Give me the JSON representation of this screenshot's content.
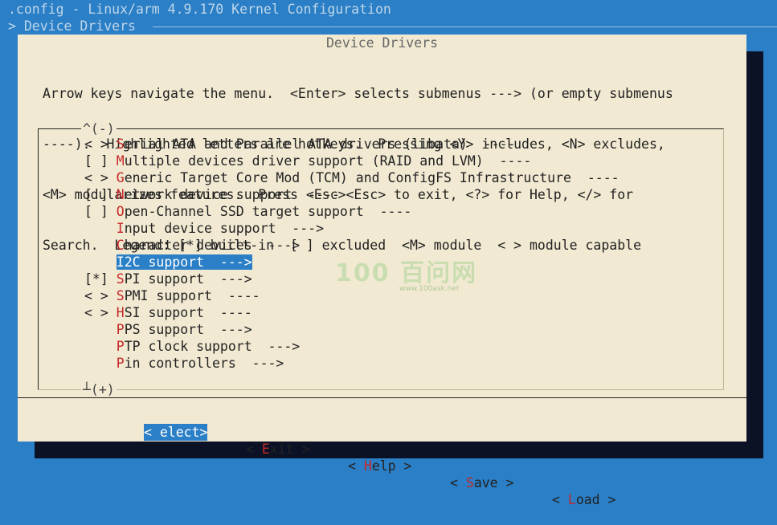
{
  "window": {
    "title": ".config - Linux/arm 4.9.170 Kernel Configuration",
    "breadcrumb": "> Device Drivers"
  },
  "dialog": {
    "title": "Device Drivers",
    "help_lines": [
      "Arrow keys navigate the menu.  <Enter> selects submenus ---> (or empty submenus",
      "----).  Highlighted letters are hotkeys.  Pressing <Y> includes, <N> excludes,",
      "<M> modularizes features.  Press <Esc><Esc> to exit, <?> for Help, </> for",
      "Search.  Legend: [*] built-in  [ ] excluded  <M> module  < > module capable"
    ],
    "scroll_up": "^(-)",
    "scroll_down": "┴(+)"
  },
  "menu": {
    "items": [
      {
        "prefix": "< > ",
        "hotkey": "S",
        "rest": "erial ATA and Parallel ATA drivers (libata)  ----"
      },
      {
        "prefix": "[ ] ",
        "hotkey": "M",
        "rest": "ultiple devices driver support (RAID and LVM)  ----"
      },
      {
        "prefix": "< > ",
        "hotkey": "G",
        "rest": "eneric Target Core Mod (TCM) and ConfigFS Infrastructure  ----"
      },
      {
        "prefix": "[ ] ",
        "hotkey": "N",
        "rest": "etwork device support  ----"
      },
      {
        "prefix": "[ ] ",
        "hotkey": "O",
        "rest": "pen-Channel SSD target support  ----"
      },
      {
        "prefix": "    ",
        "hotkey": "I",
        "rest": "nput device support  --->"
      },
      {
        "prefix": "    ",
        "hotkey": "C",
        "rest": "haracter devices  --->"
      },
      {
        "prefix": "    ",
        "hotkey": "I",
        "rest": "2C support  --->",
        "selected": true
      },
      {
        "prefix": "[*] ",
        "hotkey": "S",
        "rest": "PI support  --->"
      },
      {
        "prefix": "< > ",
        "hotkey": "S",
        "rest": "PMI support  ----"
      },
      {
        "prefix": "< > ",
        "hotkey": "H",
        "rest": "SI support  ----"
      },
      {
        "prefix": "    ",
        "hotkey": "P",
        "rest": "PS support  --->"
      },
      {
        "prefix": "    ",
        "hotkey": "P",
        "rest": "TP clock support  --->"
      },
      {
        "prefix": "    ",
        "hotkey": "P",
        "rest": "in controllers  --->"
      }
    ]
  },
  "buttons": {
    "select": {
      "pre": "< ",
      "hotkey": "",
      "rest": "elect>",
      "active": true
    },
    "exit": {
      "pre": "< ",
      "hotkey": "E",
      "rest": "xit >"
    },
    "help": {
      "pre": "< ",
      "hotkey": "H",
      "rest": "elp >"
    },
    "save": {
      "pre": "< ",
      "hotkey": "S",
      "rest": "ave >"
    },
    "load": {
      "pre": "< ",
      "hotkey": "L",
      "rest": "oad >"
    }
  },
  "watermark": {
    "logo": "100 百问网",
    "url": "www.100ask.net"
  },
  "colors": {
    "background": "#2a7fc6",
    "dialog": "#f1e9d2",
    "hotkey": "#c62828",
    "selection": "#2a7fc6",
    "cursor": "#8a9a1c"
  }
}
